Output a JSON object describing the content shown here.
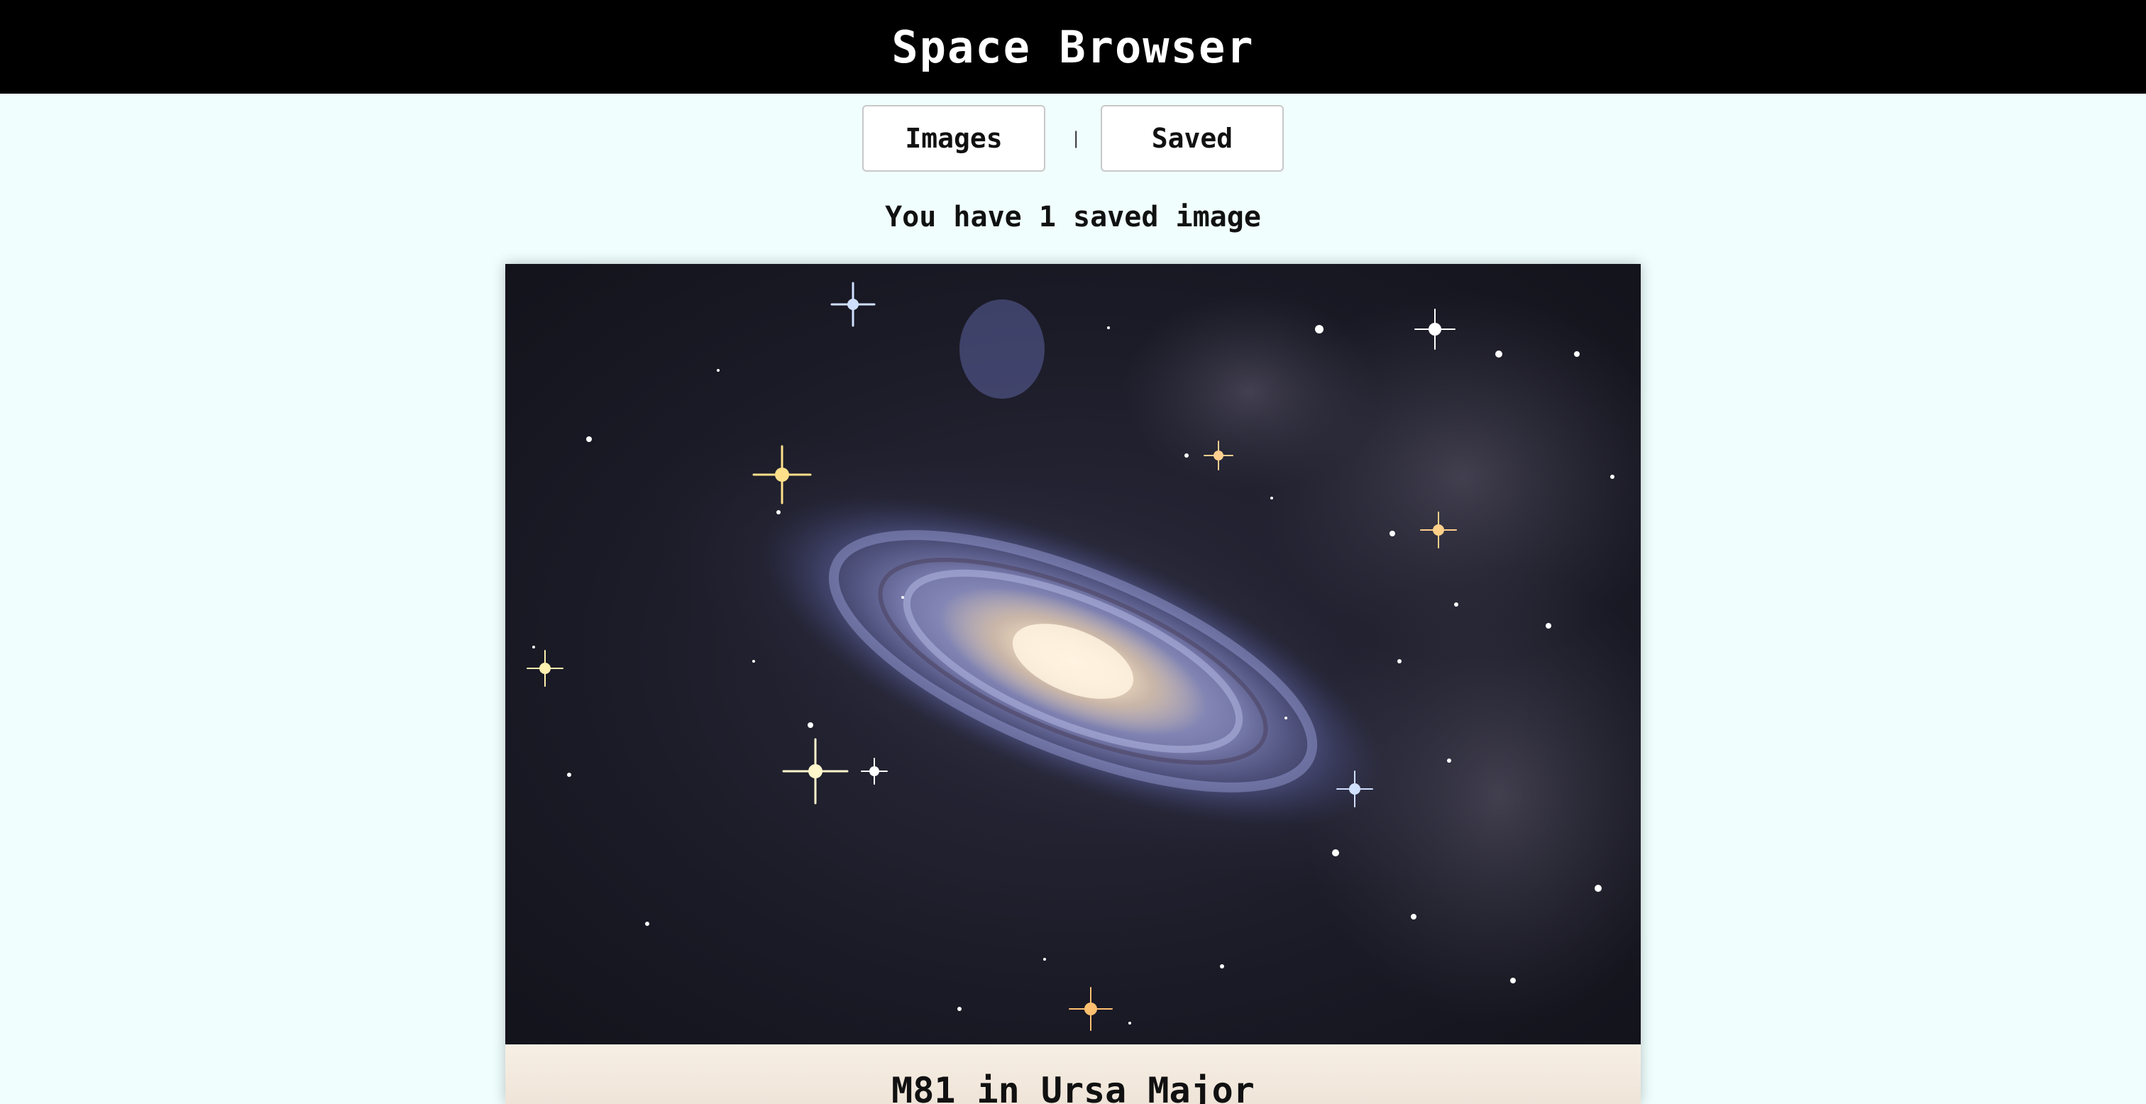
{
  "app": {
    "title": "Space Browser"
  },
  "nav": {
    "images_label": "Images",
    "separator": "|",
    "saved_label": "Saved"
  },
  "status": {
    "text": "You have 1 saved image"
  },
  "saved_images": [
    {
      "title": "M81 in Ursa Major",
      "image_icon": "spiral-galaxy-image"
    }
  ]
}
